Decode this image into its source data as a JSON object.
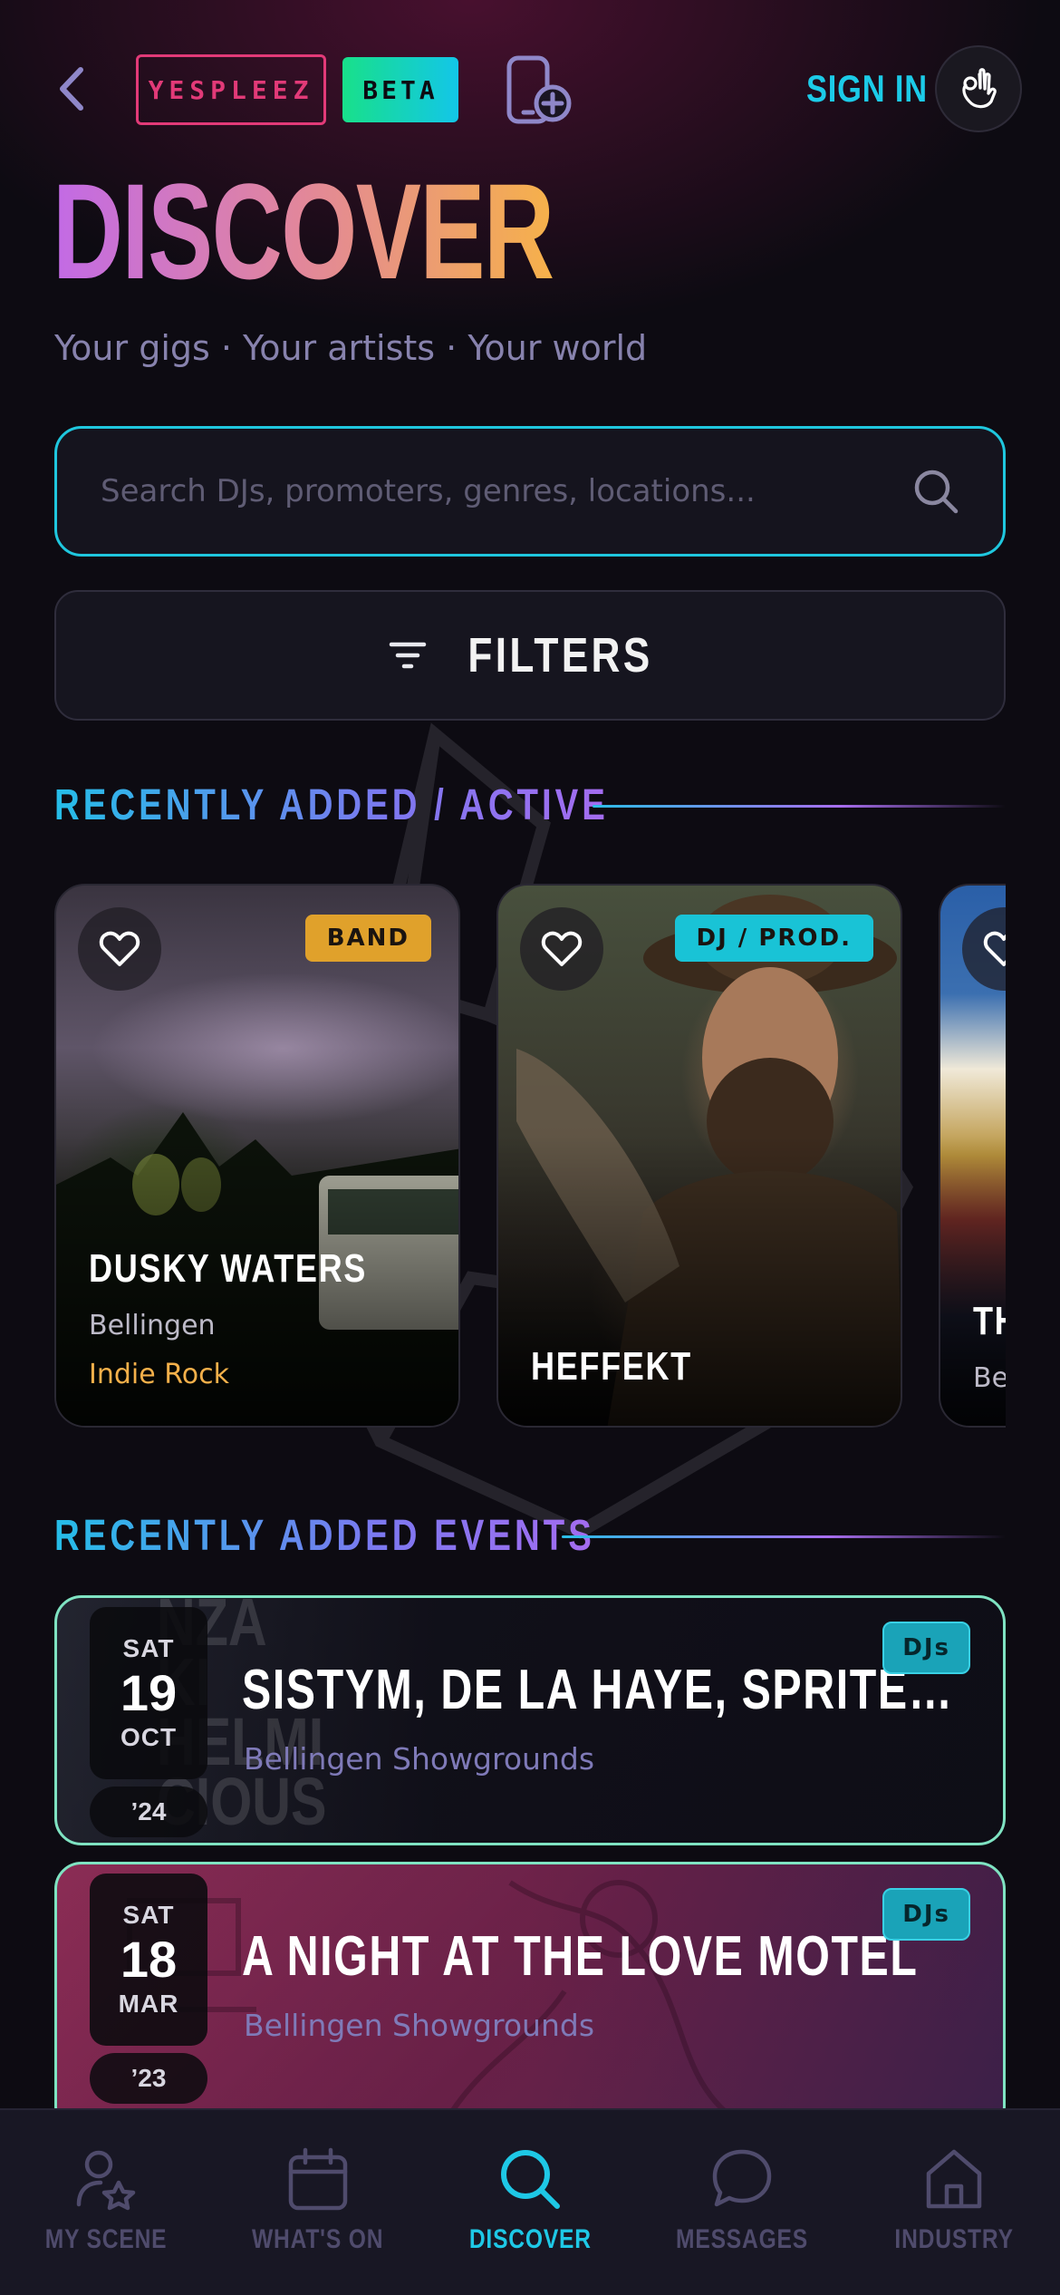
{
  "header": {
    "logo_text": "YESPLEEZ",
    "beta_label": "BETA",
    "sign_in_label": "SIGN IN"
  },
  "page": {
    "title": "DISCOVER",
    "tagline": "Your gigs · Your artists · Your world"
  },
  "search": {
    "placeholder": "Search DJs, promoters, genres, locations...",
    "value": ""
  },
  "filters": {
    "label": "FILTERS"
  },
  "sections": {
    "recent_active": "RECENTLY ADDED / ACTIVE",
    "recent_events": "RECENTLY ADDED EVENTS"
  },
  "artists": [
    {
      "name": "DUSKY WATERS",
      "location": "Bellingen",
      "genre": "Indie Rock",
      "type": "BAND",
      "type_color": "#e0a12b"
    },
    {
      "name": "HEFFEKT",
      "location": "",
      "genre": "",
      "type": "DJ / PROD.",
      "type_color": "#19c3d6"
    },
    {
      "name": "TH",
      "location": "Bel",
      "genre": "",
      "type": "",
      "type_color": ""
    }
  ],
  "events": [
    {
      "day_of_week": "SAT",
      "day": "19",
      "month": "OCT",
      "year": "’24",
      "title": "SISTYM, DE LA HAYE, SPRITE, BONZA, KIKI, HELMI, PRECIOUS",
      "venue": "Bellingen Showgrounds",
      "tag": "DJs",
      "poster_text": "NZA\nKI\nHELMI\nCIOUS"
    },
    {
      "day_of_week": "SAT",
      "day": "18",
      "month": "MAR",
      "year": "’23",
      "title": "A NIGHT AT THE LOVE MOTEL",
      "venue": "Bellingen Showgrounds",
      "tag": "DJs",
      "poster_text": ""
    }
  ],
  "nav": {
    "items": [
      {
        "label": "MY SCENE",
        "icon": "user-star-icon"
      },
      {
        "label": "WHAT'S ON",
        "icon": "calendar-icon"
      },
      {
        "label": "DISCOVER",
        "icon": "search-icon",
        "active": true
      },
      {
        "label": "MESSAGES",
        "icon": "chat-bubble-icon"
      },
      {
        "label": "INDUSTRY",
        "icon": "home-icon"
      }
    ]
  },
  "colors": {
    "accent_cyan": "#1ccbe8",
    "accent_pink": "#e23a78",
    "accent_mint": "#7fe3c2",
    "title_gradient": [
      "#c26ae6",
      "#e2879a",
      "#f6b14a"
    ],
    "background": "#0d0b12"
  }
}
